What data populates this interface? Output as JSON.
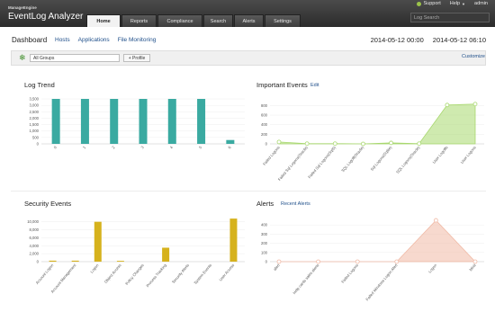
{
  "app": {
    "brand_small": "ManageEngine",
    "brand_name": "EventLog Analyzer"
  },
  "tabs": [
    {
      "label": "Home",
      "active": true
    },
    {
      "label": "Reports",
      "active": false
    },
    {
      "label": "Compliance",
      "active": false
    },
    {
      "label": "Search",
      "active": false
    },
    {
      "label": "Alerts",
      "active": false
    },
    {
      "label": "Settings",
      "active": false
    }
  ],
  "toplinks": {
    "support": "Support",
    "help": "Help",
    "admin": "admin"
  },
  "search": {
    "placeholder": "Log Search"
  },
  "subnav": {
    "title": "Dashboard",
    "links": [
      "Hosts",
      "Applications",
      "File Monitoring"
    ],
    "time_from": "2014-05-12 00:00",
    "time_to": "2014-05-12 06:10"
  },
  "filter": {
    "group": "All Groups",
    "profile": "+ Profile",
    "customize": "Customize"
  },
  "widgets": {
    "log_trend": {
      "title": "Log Trend"
    },
    "important_events": {
      "title": "Important Events",
      "edit": "Edit"
    },
    "security_events": {
      "title": "Security Events"
    },
    "alerts": {
      "title": "Alerts",
      "link": "Recent Alerts"
    }
  },
  "colors": {
    "teal": "#3aaaa1",
    "green": "#a8d86e",
    "gold": "#d6b21d",
    "salmon": "#f0b9a5"
  },
  "chart_data": [
    {
      "type": "bar",
      "title": "Log Trend",
      "categories": [
        "0",
        "1",
        "2",
        "3",
        "4",
        "5",
        "6"
      ],
      "values": [
        3500,
        3500,
        3500,
        3500,
        3500,
        3500,
        300
      ],
      "yticks": [
        "3,500",
        "3,000",
        "2,500",
        "2,000",
        "1,500",
        "1,000",
        "500",
        "0"
      ],
      "ylim": [
        0,
        3500
      ],
      "color": "#3aaaa1"
    },
    {
      "type": "area",
      "title": "Important Events",
      "categories": [
        "Failed Logons",
        "Failed Sql Logons(Oracle)",
        "Failed Sql Logons(SqlS)",
        "SQL Logoff(Oracle)",
        "Sql Logons(Sqlite)",
        "SQL Logons(Oracle)",
        "User Logoffs",
        "User Logons"
      ],
      "values": [
        40,
        5,
        5,
        0,
        20,
        5,
        810,
        830
      ],
      "yticks": [
        "800",
        "600",
        "400",
        "200",
        "0"
      ],
      "ylim": [
        0,
        900
      ],
      "color": "#a8d86e"
    },
    {
      "type": "bar",
      "title": "Security Events",
      "categories": [
        "Account Logon",
        "Account Management",
        "Logon",
        "Object Access",
        "Policy Changes",
        "Process Tracking",
        "Security Alerts",
        "System Events",
        "User Access"
      ],
      "values": [
        250,
        250,
        10000,
        200,
        0,
        3500,
        0,
        0,
        10800
      ],
      "yticks": [
        "10,000",
        "8,000",
        "6,000",
        "4,000",
        "2,000",
        "0"
      ],
      "ylim": [
        0,
        11500
      ],
      "color": "#d6b21d"
    },
    {
      "type": "area",
      "title": "Alerts",
      "categories": [
        "alert",
        "Help cards sales alerts",
        "Failed Logons",
        "Failed Windows Logon Alert",
        "Logon",
        "Minit"
      ],
      "values": [
        0,
        0,
        0,
        0,
        450,
        0
      ],
      "yticks": [
        "400",
        "300",
        "200",
        "100",
        "0"
      ],
      "ylim": [
        0,
        480
      ],
      "color": "#f0b9a5"
    }
  ]
}
